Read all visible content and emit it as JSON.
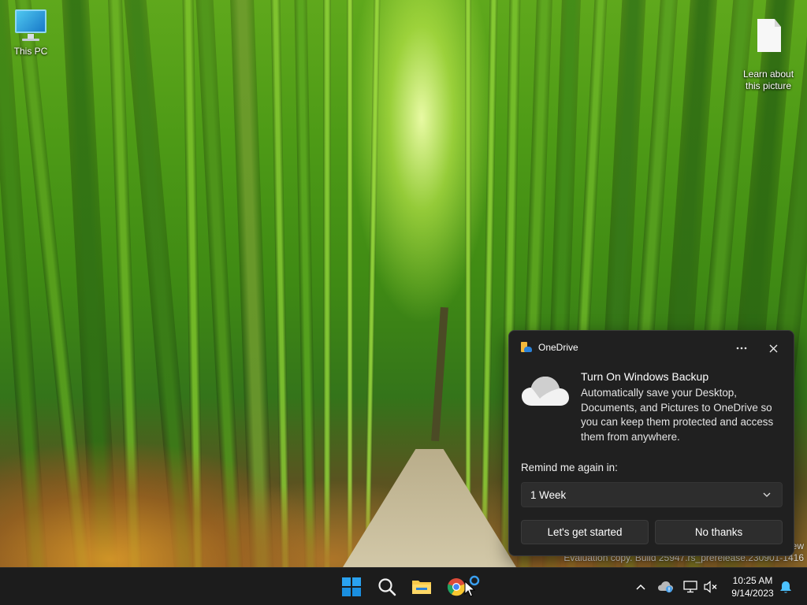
{
  "desktop": {
    "icons": [
      {
        "label": "This PC",
        "icon": "this-pc-icon"
      },
      {
        "label": "Learn about\nthis picture",
        "icon": "document-icon"
      }
    ],
    "watermark": {
      "line1_fragment": "ew",
      "line2": "Evaluation copy. Build 25947.rs_prerelease.230901-1416"
    }
  },
  "notification": {
    "app_name": "OneDrive",
    "more_icon": "more-options-icon",
    "close_icon": "close-icon",
    "title": "Turn On Windows Backup",
    "body": "Automatically save your Desktop, Documents, and Pictures to OneDrive so you can keep them protected and access them from anywhere.",
    "remind_label": "Remind me again in:",
    "remind_selected": "1 Week",
    "primary_button": "Let's get started",
    "secondary_button": "No thanks"
  },
  "taskbar": {
    "pinned": [
      {
        "name": "start",
        "icon": "windows-logo-icon"
      },
      {
        "name": "search",
        "icon": "search-icon"
      },
      {
        "name": "file-explorer",
        "icon": "folder-icon"
      },
      {
        "name": "chrome",
        "icon": "chrome-icon"
      },
      {
        "name": "loading",
        "icon": "loading-ring-icon"
      }
    ],
    "tray": [
      {
        "name": "show-hidden",
        "icon": "chevron-up-icon"
      },
      {
        "name": "onedrive",
        "icon": "onedrive-status-icon"
      },
      {
        "name": "network",
        "icon": "network-icon"
      },
      {
        "name": "volume",
        "icon": "volume-muted-icon"
      },
      {
        "name": "notifications",
        "icon": "bell-icon"
      }
    ],
    "time": "10:25 AM",
    "date": "9/14/2023"
  },
  "colors": {
    "toast_bg": "#202020",
    "taskbar_bg": "#1c1c1c",
    "accent_blue": "#0078d4",
    "notification_blue": "#4cc2ff"
  }
}
